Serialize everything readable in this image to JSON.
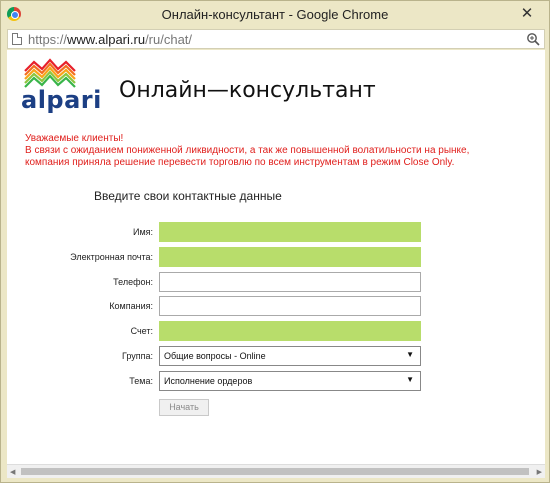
{
  "window": {
    "title": "Онлайн-консультант - Google Chrome",
    "close_symbol": "✕"
  },
  "address": {
    "prefix": "https://",
    "domain": "www.alpari.ru",
    "path": "/ru/chat/"
  },
  "logo": {
    "text": "alpari",
    "colors": [
      "#e7202a",
      "#f36f21",
      "#f9a51a",
      "#8dc63f",
      "#39b54a"
    ]
  },
  "page": {
    "title": "Онлайн—консультант"
  },
  "notice": {
    "line1": "Уважаемые клиенты!",
    "line2": "В связи с ожиданием пониженной ликвидности, а так же повышенной волатильности на рынке,",
    "line3": "компания приняла решение перевести торговлю по всем инструментам в режим Close Only.",
    "color": "#e0201d"
  },
  "form": {
    "title": "Введите свои контактные данные",
    "name_label": "Имя:",
    "email_label": "Электронная почта:",
    "phone_label": "Телефон:",
    "company_label": "Компания:",
    "account_label": "Счет:",
    "group_label": "Группа:",
    "group_value": "Общие вопросы - Online",
    "topic_label": "Тема:",
    "topic_value": "Исполнение ордеров",
    "submit_label": "Начать",
    "required_color": "#b8dd6b"
  }
}
